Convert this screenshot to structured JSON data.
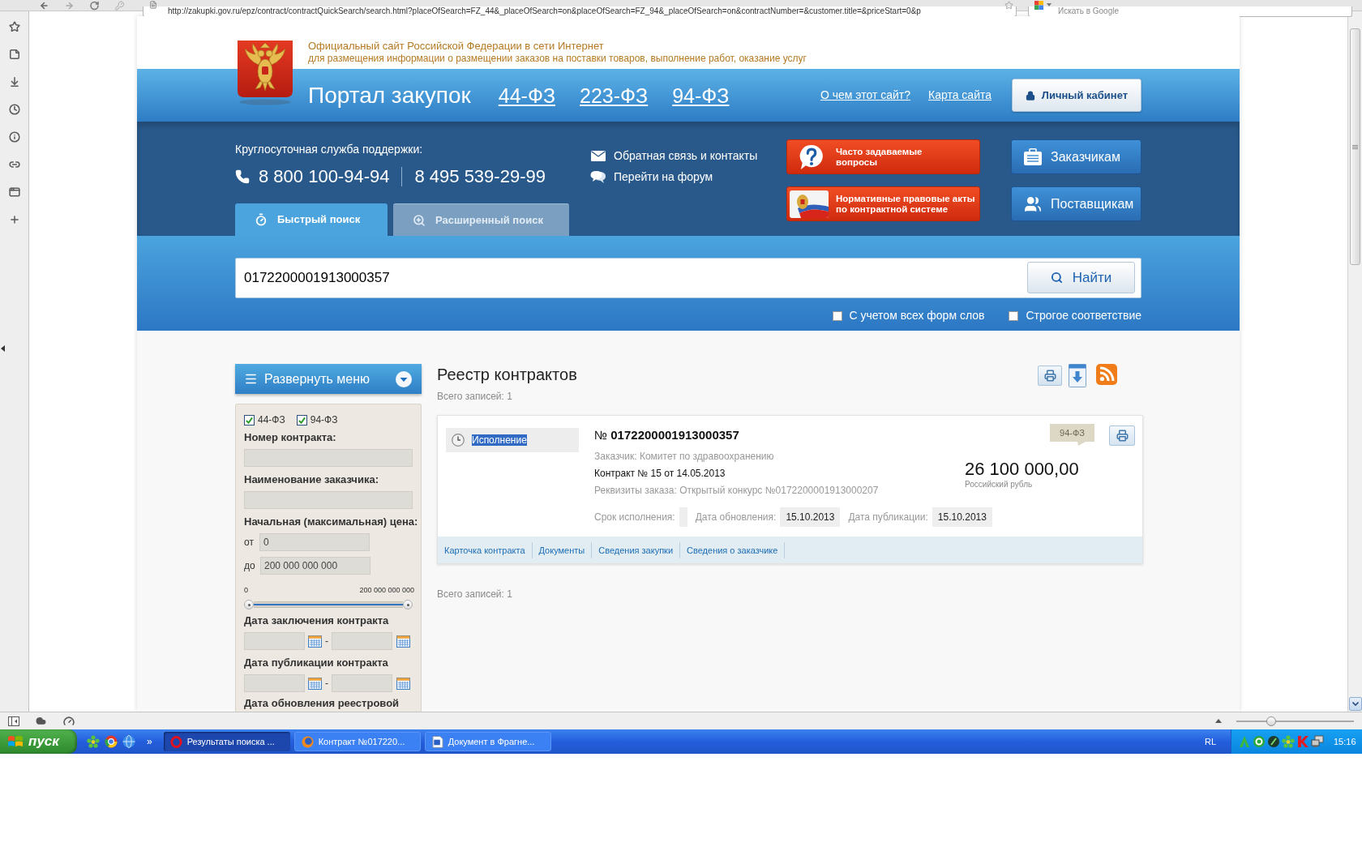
{
  "browser": {
    "address": "http://zakupki.gov.ru/epz/contract/contractQuickSearch/search.html?placeOfSearch=FZ_44&_placeOfSearch=on&placeOfSearch=FZ_94&_placeOfSearch=on&contractNumber=&customer.title=&priceStart=0&p",
    "search_placeholder": "Искать в Google",
    "zoom_slider": {
      "level": 0.28
    }
  },
  "header": {
    "tagline": "Официальный сайт Российской Федерации в сети Интернет",
    "subtitle": "для размещения информации о размещении заказов на поставки товаров, выполнение работ, оказание услуг",
    "portal_title": "Портал закупок",
    "law_links": [
      "44-ФЗ",
      "223-ФЗ",
      "94-ФЗ"
    ],
    "links": [
      "О чем этот сайт?",
      "Карта сайта"
    ],
    "cabinet_button": "Личный кабинет"
  },
  "support": {
    "label": "Круглосуточная служба поддержки:",
    "phones": [
      "8 800 100-94-94",
      "8 495 539-29-99"
    ]
  },
  "contact_links": [
    {
      "kind": "mail",
      "label": "Обратная связь и контакты"
    },
    {
      "kind": "forum",
      "label": "Перейти на форум"
    }
  ],
  "red_buttons": [
    {
      "kind": "faq",
      "label": "Часто задаваемые вопросы"
    },
    {
      "kind": "acts",
      "label": "Нормативные правовые акты по контрактной системе"
    }
  ],
  "blue_buttons": [
    {
      "kind": "customers",
      "label": "Заказчикам"
    },
    {
      "kind": "suppliers",
      "label": "Поставщикам"
    }
  ],
  "search_tabs": [
    {
      "label": "Быстрый поиск",
      "selected": true
    },
    {
      "label": "Расширенный поиск",
      "selected": false
    }
  ],
  "search": {
    "value": "0172200001913000357",
    "button": "Найти",
    "options": [
      {
        "label": "С учетом всех форм слов",
        "checked": false
      },
      {
        "label": "Строгое соответствие",
        "checked": false
      }
    ]
  },
  "filter": {
    "menu_button": "Развернуть меню",
    "laws": [
      {
        "label": "44-ФЗ",
        "checked": true
      },
      {
        "label": "94-ФЗ",
        "checked": true
      }
    ],
    "contract_number_label": "Номер контракта:",
    "customer_label": "Наименование заказчика:",
    "price_label": "Начальная (максимальная) цена:",
    "price_from": {
      "label": "от",
      "value": "0"
    },
    "price_to": {
      "label": "до",
      "value": "200 000 000 000"
    },
    "price_slider": {
      "min_label": "0",
      "max_label": "200 000 000 000",
      "level": 1
    },
    "date_sections": [
      {
        "label": "Дата заключения контракта",
        "separator": "-"
      },
      {
        "label": "Дата публикации контракта",
        "separator": "-"
      }
    ],
    "last_label": "Дата обновления реестровой"
  },
  "registry": {
    "title": "Реестр контрактов",
    "total_top": "Всего записей: 1",
    "contracts": [
      {
        "status": "Исполнение",
        "status_text_selected": true,
        "number": "№ **0172200001913000357**",
        "customer": "Заказчик: Комитет по здравоохранению",
        "contract": "Контракт № 15 от 14.05.2013",
        "order": "Реквизиты заказа: Открытый конкурс №0172200001913000207",
        "dates": [
          {
            "label": "Срок исполнения:"
          },
          {
            "label": "Дата обновления:",
            "value": "15.10.2013"
          },
          {
            "label": "Дата публикации:",
            "value": "15.10.2013"
          }
        ],
        "law_badge": "94-ФЗ",
        "price": "26 100 000,00",
        "currency": "Российский рубль",
        "links": [
          "Карточка контракта",
          "Документы",
          "Сведения закупки",
          "Сведения о заказчике"
        ]
      }
    ],
    "total_bottom": "Всего записей: 1"
  },
  "taskbar": {
    "start": "пуск",
    "quick_launch_more": "»",
    "tasks": [
      {
        "kind": "opera",
        "label": "Результаты поиска ...",
        "selected": true
      },
      {
        "kind": "firefox",
        "label": "Контракт №017220...",
        "selected": false
      },
      {
        "kind": "word",
        "label": "Документ в Фрагне...",
        "selected": false
      }
    ],
    "language": "RL",
    "time": "15:16"
  }
}
